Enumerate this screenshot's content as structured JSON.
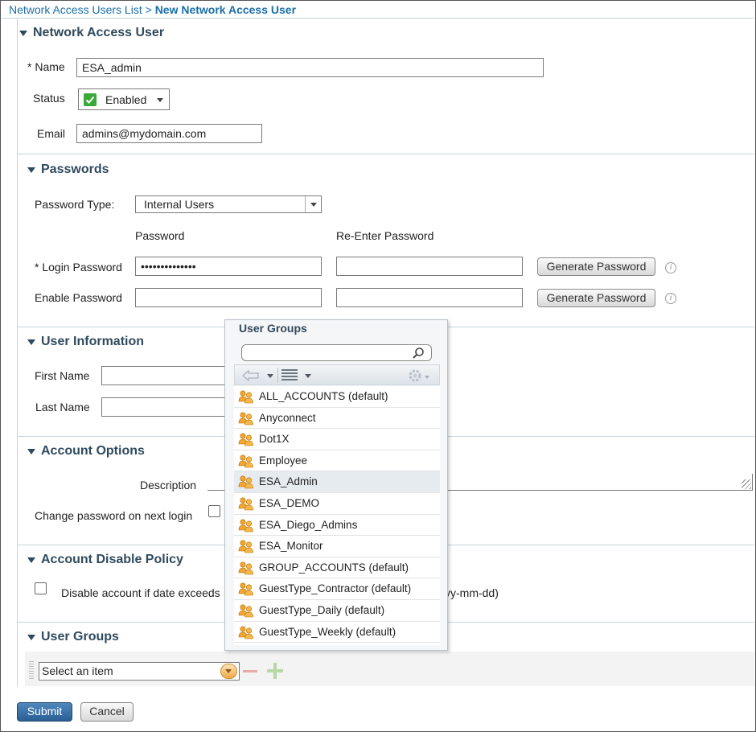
{
  "breadcrumb": {
    "parent": "Network Access Users List",
    "separator": " > ",
    "current": "New Network Access User"
  },
  "sections": {
    "user": {
      "title": "Network Access User",
      "name_label": "* Name",
      "name_value": "ESA_admin",
      "status_label": "Status",
      "status_value": "Enabled",
      "email_label": "Email",
      "email_value": "admins@mydomain.com"
    },
    "passwords": {
      "title": "Passwords",
      "type_label": "Password Type:",
      "type_value": "Internal Users",
      "col_password": "Password",
      "col_reenter": "Re-Enter Password",
      "login_label": "* Login Password",
      "login_value": "••••••••••••••",
      "enable_label": "Enable Password",
      "generate_label": "Generate Password"
    },
    "user_info": {
      "title": "User Information",
      "first_name_label": "First Name",
      "last_name_label": "Last Name"
    },
    "account_options": {
      "title": "Account Options",
      "description_label": "Description",
      "change_pw_label": "Change password on next login"
    },
    "disable_policy": {
      "title": "Account Disable Policy",
      "disable_label": "Disable account if date exceeds",
      "date_hint": "yy-mm-dd)"
    },
    "user_groups": {
      "title": "User Groups",
      "select_placeholder": "Select an item"
    }
  },
  "popup": {
    "title": "User Groups",
    "items": [
      "ALL_ACCOUNTS (default)",
      "Anyconnect",
      "Dot1X",
      "Employee",
      "ESA_Admin",
      "ESA_DEMO",
      "ESA_Diego_Admins",
      "ESA_Monitor",
      "GROUP_ACCOUNTS (default)",
      "GuestType_Contractor (default)",
      "GuestType_Daily (default)",
      "GuestType_Weekly (default)"
    ],
    "selected_index": 4
  },
  "footer": {
    "submit_label": "Submit",
    "cancel_label": "Cancel"
  },
  "colors": {
    "link": "#1a6ea8",
    "section_title": "#2f4a5e",
    "submit_bg": "#2f6aa0",
    "status_green": "#3aa83a"
  }
}
